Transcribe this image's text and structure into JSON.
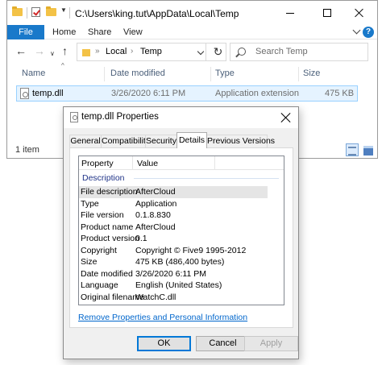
{
  "explorer": {
    "title_path": "C:\\Users\\king.tut\\AppData\\Local\\Temp",
    "ribbon_tabs": {
      "file": "File",
      "home": "Home",
      "share": "Share",
      "view": "View"
    },
    "help": "?",
    "address": {
      "crumb1": "Local",
      "crumb2": "Temp",
      "sep": "»",
      "sep2": "›"
    },
    "search_placeholder": "Search Temp",
    "columns": {
      "name": "Name",
      "date_modified": "Date modified",
      "type": "Type",
      "size": "Size"
    },
    "file": {
      "name": "temp.dll",
      "date_modified": "3/26/2020 6:11 PM",
      "type": "Application extension",
      "size": "475 KB"
    },
    "status": "1 item"
  },
  "dialog": {
    "title": "temp.dll Properties",
    "tabs": {
      "general": "General",
      "compatibility": "Compatibility",
      "security": "Security",
      "details": "Details",
      "previous_versions": "Previous Versions"
    },
    "list_header": {
      "property": "Property",
      "value": "Value"
    },
    "group": "Description",
    "rows": [
      {
        "property": "File description",
        "value": "AfterCloud"
      },
      {
        "property": "Type",
        "value": "Application"
      },
      {
        "property": "File version",
        "value": "0.1.8.830"
      },
      {
        "property": "Product name",
        "value": "AfterCloud"
      },
      {
        "property": "Product version",
        "value": "0.1"
      },
      {
        "property": "Copyright",
        "value": "Copyright © Five9 1995-2012"
      },
      {
        "property": "Size",
        "value": "475 KB (486,400 bytes)"
      },
      {
        "property": "Date modified",
        "value": "3/26/2020 6:11 PM"
      },
      {
        "property": "Language",
        "value": "English (United States)"
      },
      {
        "property": "Original filename",
        "value": "WatchC.dll"
      }
    ],
    "remove_link": "Remove Properties and Personal Information",
    "buttons": {
      "ok": "OK",
      "cancel": "Cancel",
      "apply": "Apply"
    }
  }
}
